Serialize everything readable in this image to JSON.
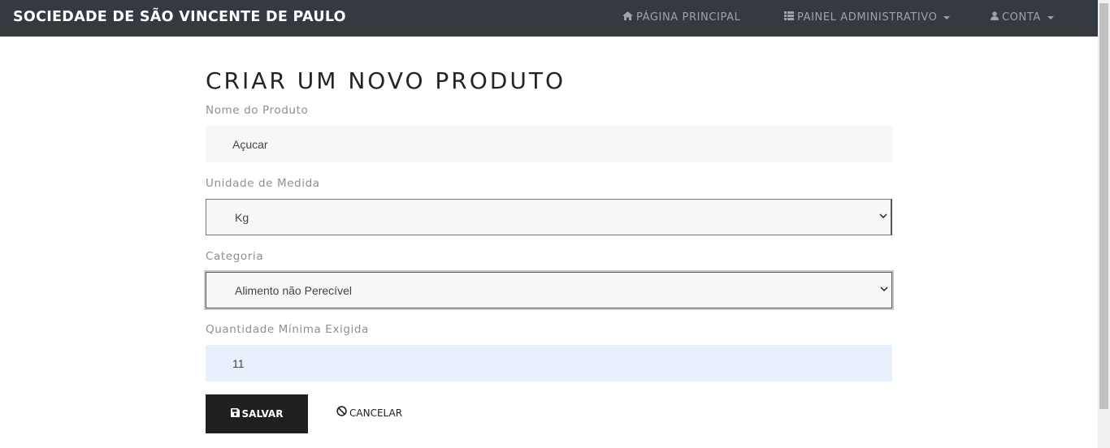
{
  "navbar": {
    "brand": "SOCIEDADE DE SÃO VINCENTE DE PAULO",
    "home_label": "PÁGINA PRINCIPAL",
    "admin_label": "PAINEL ADMINISTRATIVO",
    "account_label": "CONTA"
  },
  "page": {
    "title": "CRIAR UM NOVO PRODUTO"
  },
  "form": {
    "name_label": "Nome do Produto",
    "name_value": "Açucar",
    "unit_label": "Unidade de Medida",
    "unit_value": "Kg",
    "category_label": "Categoria",
    "category_value": "Alimento não Perecível",
    "qty_label": "Quantidade Mínima Exigida",
    "qty_value": "11"
  },
  "actions": {
    "save_label": "SALVAR",
    "cancel_label": "CANCELAR"
  },
  "icons": {
    "home": "home-icon",
    "admin": "list-icon",
    "account": "user-icon",
    "save": "floppy-disk-icon",
    "cancel": "ban-icon"
  },
  "colors": {
    "navbar_bg": "#343a40",
    "save_button_bg": "#1f1f1f",
    "autofill_bg": "#e8f0fe"
  }
}
